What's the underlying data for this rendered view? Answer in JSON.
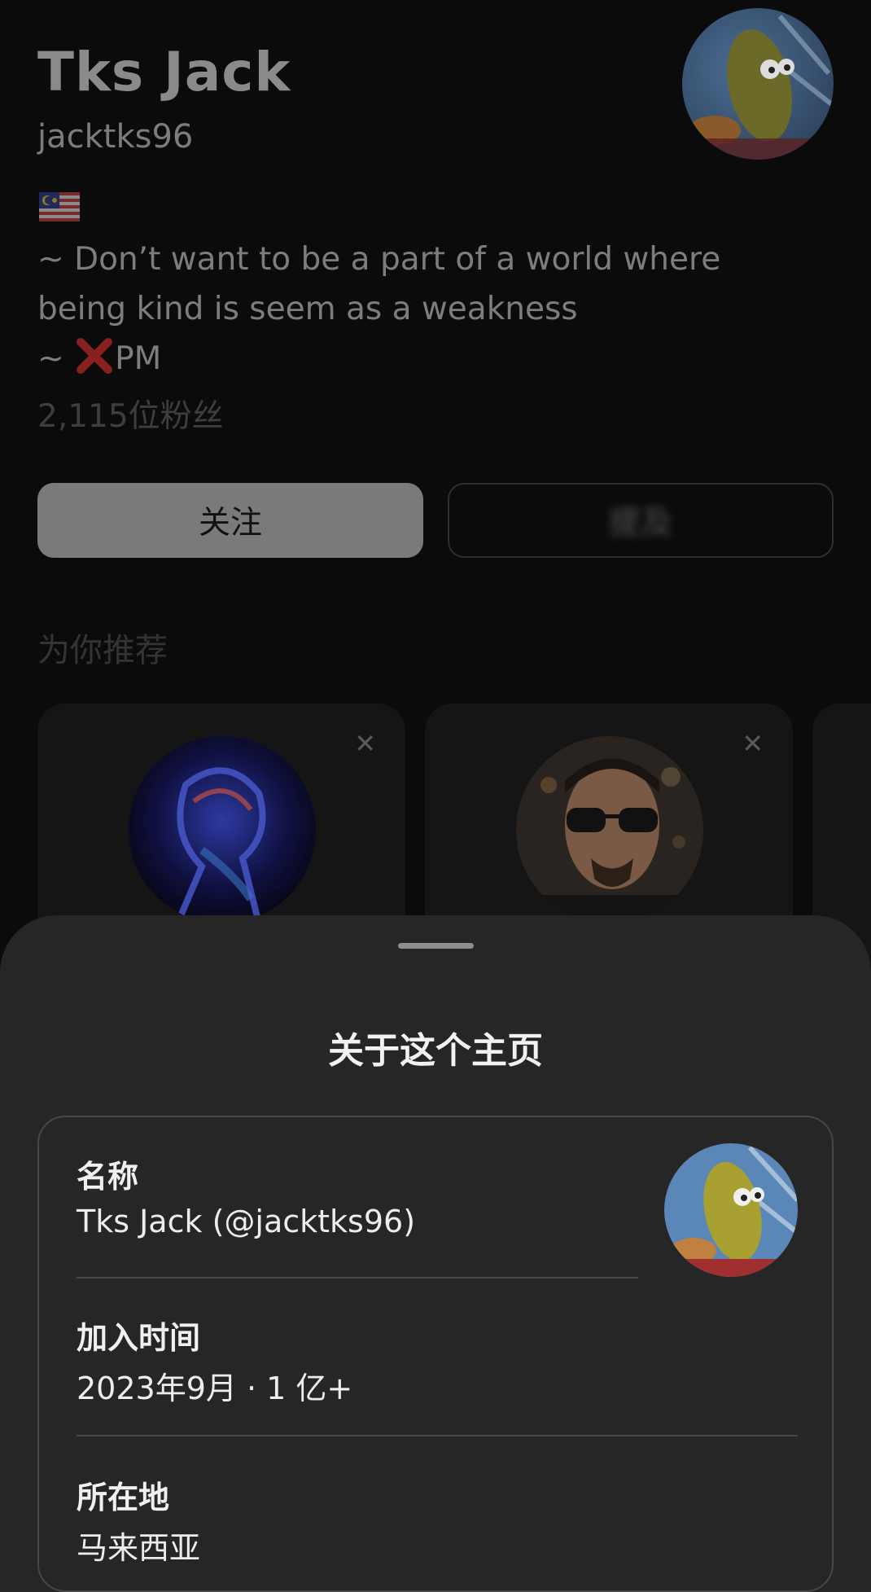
{
  "profile": {
    "display_name": "Tks Jack",
    "handle": "jacktks96",
    "bio_lines": [
      " ~ Don’t want to be a part of a world where",
      "being kind is seem as a weakness",
      " ~ ",
      "PM"
    ],
    "followers": "2,115位粉丝",
    "follow_label": "关注",
    "mention_label": "提及",
    "flag_icon": "malaysia-flag-icon",
    "cross_icon": "red-cross-mark-icon"
  },
  "recommendations": {
    "title": "为你推荐",
    "close_glyph": "✕"
  },
  "sheet": {
    "title": "关于这个主页",
    "name_label": "名称",
    "name_value": "Tks Jack (@jacktks96)",
    "joined_label": "加入时间",
    "joined_value": "2023年9月 · 1 亿+",
    "location_label": "所在地",
    "location_value": "马来西亚"
  },
  "colors": {
    "background": "#0b0b0b",
    "sheet": "#262626",
    "follow_button": "#7a7a7a"
  }
}
